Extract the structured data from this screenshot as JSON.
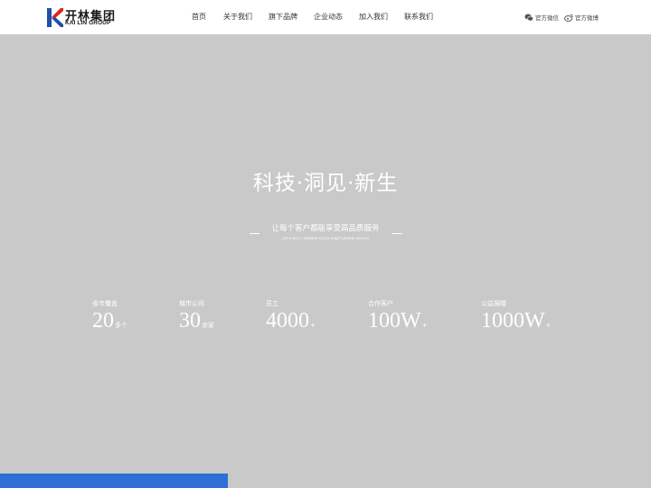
{
  "brand": {
    "name_cn": "开林集团",
    "name_en": "KAI LIN GROUP",
    "colors": {
      "red": "#d8251d",
      "blue": "#1f4fa8"
    }
  },
  "nav": {
    "items": [
      {
        "label": "首页"
      },
      {
        "label": "关于我们"
      },
      {
        "label": "旗下品牌"
      },
      {
        "label": "企业动态"
      },
      {
        "label": "加入我们"
      },
      {
        "label": "联系我们"
      }
    ]
  },
  "social": {
    "wechat": {
      "label": "官方微信",
      "icon": "wechat-icon"
    },
    "weibo": {
      "label": "官方微博",
      "icon": "weibo-icon"
    }
  },
  "hero": {
    "title": "科技·洞见·新生",
    "tagline_cn": "让每个客户都能享受高品质服务",
    "tagline_en": "Let Every Customer Enjoy High Quality Service"
  },
  "stats": [
    {
      "label": "省市覆盖",
      "value": "20",
      "suffix": "多个"
    },
    {
      "label": "城市公司",
      "value": "30",
      "suffix": "余家"
    },
    {
      "label": "员工",
      "value": "4000",
      "suffix": "+"
    },
    {
      "label": "合作客户",
      "value": "100W",
      "suffix": "+"
    },
    {
      "label": "公益捐赠",
      "value": "1000W",
      "suffix": "+"
    }
  ],
  "theme": {
    "hero_background": "#c9c9c9",
    "accent_bar": "#2f6fd6"
  }
}
